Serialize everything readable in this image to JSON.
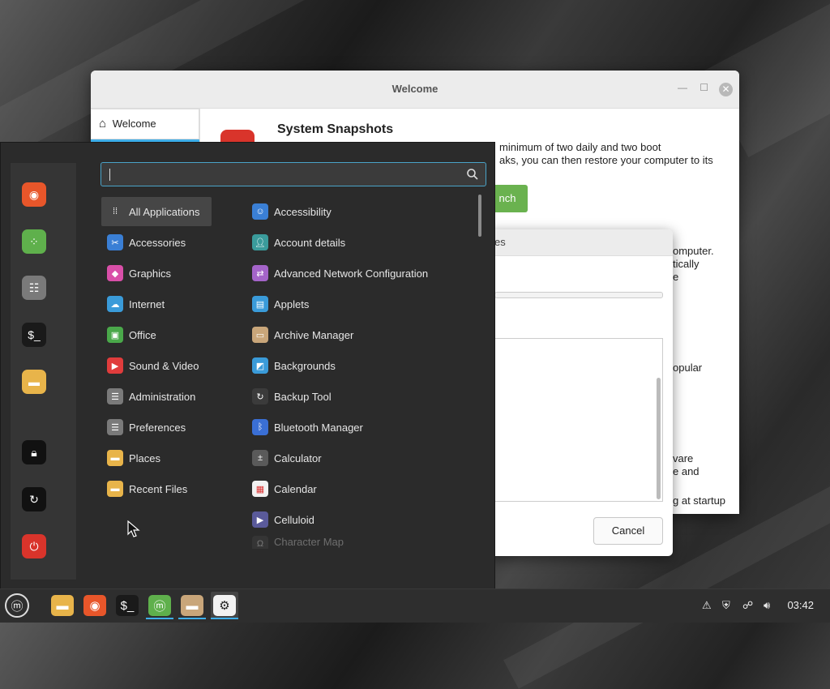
{
  "welcome_window": {
    "title": "Welcome",
    "sidebar_item": "Welcome",
    "heading": "System Snapshots",
    "paragraphs": [
      "minimum of two daily and two boot",
      "aks, you can then restore your computer to its",
      "omputer.",
      "tically",
      "e",
      "opular",
      "vare",
      "e and",
      "g at startup"
    ],
    "launch_label": "nch"
  },
  "dialog": {
    "title_fragment": "es",
    "cancel_label": "Cancel"
  },
  "menu": {
    "search": {
      "value": ""
    },
    "favorites": [
      {
        "name": "firefox-icon",
        "color": "#e8562a"
      },
      {
        "name": "software-manager-icon",
        "color": "#5fb04c"
      },
      {
        "name": "system-settings-icon",
        "color": "#7a7a7a"
      },
      {
        "name": "terminal-icon",
        "color": "#1a1a1a"
      },
      {
        "name": "files-icon",
        "color": "#e8b44a"
      },
      {
        "name": "lock-screen-icon",
        "color": "#111111"
      },
      {
        "name": "logout-icon",
        "color": "#111111"
      },
      {
        "name": "shutdown-icon",
        "color": "#d9342b"
      }
    ],
    "categories": [
      {
        "label": "All Applications",
        "icon": "grid-icon",
        "color": "#464646"
      },
      {
        "label": "Accessories",
        "icon": "scissors-icon",
        "color": "#3a7fd5"
      },
      {
        "label": "Graphics",
        "icon": "graphics-icon",
        "color": "#d94fa8"
      },
      {
        "label": "Internet",
        "icon": "cloud-icon",
        "color": "#3a9bd9"
      },
      {
        "label": "Office",
        "icon": "office-icon",
        "color": "#4aa84a"
      },
      {
        "label": "Sound & Video",
        "icon": "play-icon",
        "color": "#e03c3c"
      },
      {
        "label": "Administration",
        "icon": "admin-icon",
        "color": "#7a7a7a"
      },
      {
        "label": "Preferences",
        "icon": "preferences-icon",
        "color": "#7a7a7a"
      },
      {
        "label": "Places",
        "icon": "folder-icon",
        "color": "#e8b44a"
      },
      {
        "label": "Recent Files",
        "icon": "recent-folder-icon",
        "color": "#e8b44a"
      }
    ],
    "apps": [
      {
        "label": "Accessibility",
        "icon": "accessibility-icon",
        "color": "#3a7fd5"
      },
      {
        "label": "Account details",
        "icon": "account-icon",
        "color": "#3a9b9b"
      },
      {
        "label": "Advanced Network Configuration",
        "icon": "network-config-icon",
        "color": "#a464c9"
      },
      {
        "label": "Applets",
        "icon": "applets-icon",
        "color": "#3a9bd9"
      },
      {
        "label": "Archive Manager",
        "icon": "archive-icon",
        "color": "#c9a67a"
      },
      {
        "label": "Backgrounds",
        "icon": "backgrounds-icon",
        "color": "#3a9bd9"
      },
      {
        "label": "Backup Tool",
        "icon": "backup-icon",
        "color": "#3b3b3b"
      },
      {
        "label": "Bluetooth Manager",
        "icon": "bluetooth-icon",
        "color": "#3a6fd5"
      },
      {
        "label": "Calculator",
        "icon": "calculator-icon",
        "color": "#5a5a5a"
      },
      {
        "label": "Calendar",
        "icon": "calendar-icon",
        "color": "#f2f2f2"
      },
      {
        "label": "Celluloid",
        "icon": "celluloid-icon",
        "color": "#5a5a9a"
      },
      {
        "label": "Character Map",
        "icon": "charmap-icon",
        "color": "#4a4a4a"
      }
    ]
  },
  "taskbar": {
    "items": [
      {
        "name": "menu-button",
        "icon": "mint-logo-icon"
      },
      {
        "name": "taskbar-files",
        "icon": "files-icon"
      },
      {
        "name": "taskbar-firefox",
        "icon": "firefox-icon"
      },
      {
        "name": "taskbar-terminal",
        "icon": "terminal-icon"
      },
      {
        "name": "taskbar-mintinstall",
        "icon": "mint-welcome-icon"
      },
      {
        "name": "taskbar-archive",
        "icon": "folder-icon"
      },
      {
        "name": "taskbar-settings",
        "icon": "gear-icon"
      }
    ],
    "clock": "03:42"
  }
}
